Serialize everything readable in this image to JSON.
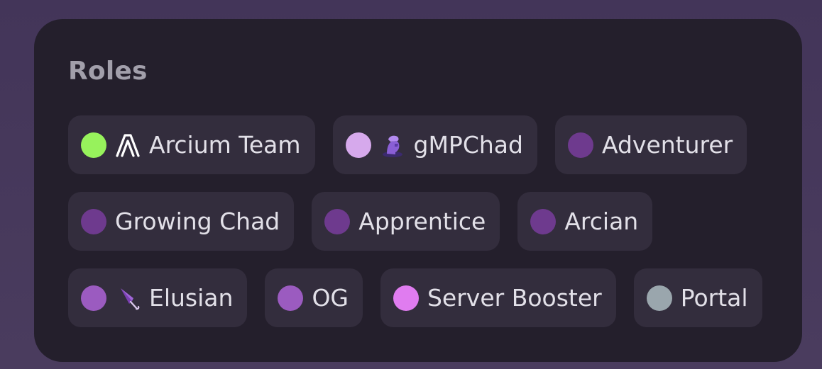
{
  "title": "Roles",
  "roles": [
    {
      "label": "Arcium Team",
      "color": "#97f25c",
      "icon": "arcium-logo-icon"
    },
    {
      "label": "gMPChad",
      "color": "#d6a9ec",
      "icon": "chad-avatar-icon"
    },
    {
      "label": "Adventurer",
      "color": "#6e3a8e"
    },
    {
      "label": "Growing Chad",
      "color": "#6e3a8e"
    },
    {
      "label": "Apprentice",
      "color": "#6e3a8e"
    },
    {
      "label": "Arcian",
      "color": "#6e3a8e"
    },
    {
      "label": "Elusian",
      "color": "#9b5bc0",
      "icon": "umbrella-icon"
    },
    {
      "label": "OG",
      "color": "#9b5bc0"
    },
    {
      "label": "Server Booster",
      "color": "#e07cf0"
    },
    {
      "label": "Portal",
      "color": "#9aa6ad"
    }
  ]
}
